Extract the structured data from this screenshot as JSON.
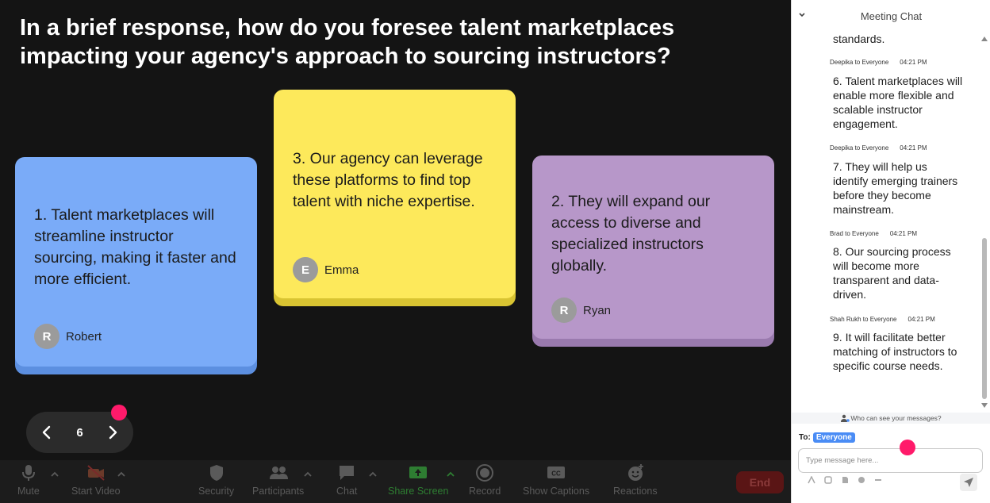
{
  "question": "In a brief response, how do you foresee talent marketplaces impacting your agency's approach to sourcing instructors?",
  "cards": [
    {
      "text": "1. Talent marketplaces will streamline instructor sourcing, making it faster and more efficient.",
      "initial": "R",
      "author": "Robert",
      "color": "#7aabf8"
    },
    {
      "text": "3. Our agency can leverage these platforms to find top talent with niche expertise.",
      "initial": "E",
      "author": "Emma",
      "color": "#fde95b"
    },
    {
      "text": "2. They will expand our access to diverse and specialized instructors globally.",
      "initial": "R",
      "author": "Ryan",
      "color": "#b797c9"
    }
  ],
  "pager": {
    "page": "6"
  },
  "toolbar": {
    "mute": "Mute",
    "start_video": "Start Video",
    "security": "Security",
    "participants": "Participants",
    "chat": "Chat",
    "share_screen": "Share Screen",
    "record": "Record",
    "show_captions": "Show Captions",
    "reactions": "Reactions",
    "end": "End"
  },
  "chat": {
    "title": "Meeting Chat",
    "messages": [
      {
        "sender": "",
        "time": "",
        "text": "standards."
      },
      {
        "sender": "Deepika to Everyone",
        "time": "04:21 PM",
        "text": "6. Talent marketplaces will enable more flexible and scalable instructor engagement."
      },
      {
        "sender": "Deepika to Everyone",
        "time": "04:21 PM",
        "text": "7. They will help us identify emerging trainers before they become mainstream."
      },
      {
        "sender": "Brad to Everyone",
        "time": "04:21 PM",
        "text": "8. Our sourcing process will become more transparent and data-driven."
      },
      {
        "sender": "Shah Rukh to Everyone",
        "time": "04:21 PM",
        "text": "9. It will facilitate better matching of instructors to specific course needs."
      }
    ],
    "who_can_see": "Who can see your messages?",
    "to_label": "To:",
    "to_value": "Everyone",
    "input_placeholder": "Type message here...",
    "input_value": ""
  },
  "colors": {
    "stage_bg": "#141414",
    "accent_blue": "#4a8cf5",
    "cursor": "#ff1a6a",
    "share_green": "#2e7d32",
    "end_red": "#5a1515"
  }
}
